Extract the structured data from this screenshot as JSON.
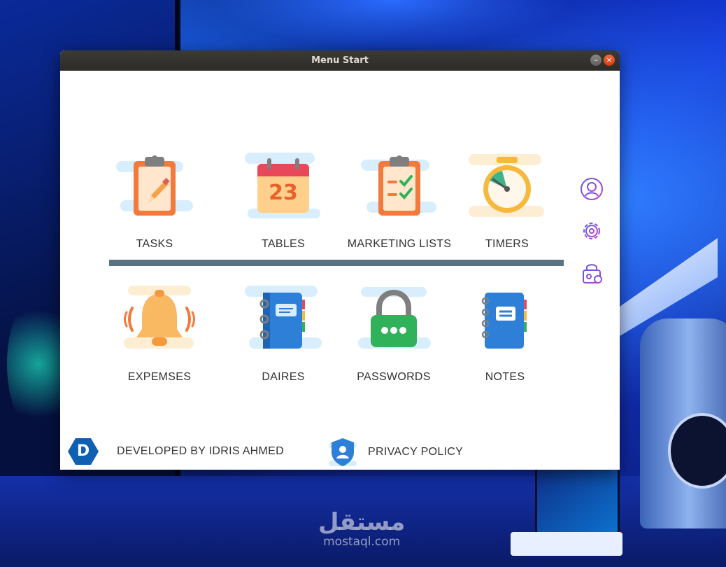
{
  "window": {
    "title": "Menu Start",
    "minimize_icon": "minimize-icon",
    "close_icon": "close-icon"
  },
  "menu_top": [
    {
      "label": "TASKS",
      "icon": "clipboard-pencil-icon"
    },
    {
      "label": "TABLES",
      "icon": "calendar-icon",
      "calendar_day": "23"
    },
    {
      "label": "MARKETING LISTS",
      "icon": "checklist-icon"
    },
    {
      "label": "TIMERS",
      "icon": "stopwatch-icon"
    }
  ],
  "menu_bottom": [
    {
      "label": "EXPEMSES",
      "icon": "bell-icon"
    },
    {
      "label": "DAIRES",
      "icon": "diary-icon"
    },
    {
      "label": "PASSWORDS",
      "icon": "padlock-icon"
    },
    {
      "label": "NOTES",
      "icon": "notebook-icon"
    }
  ],
  "side_icons": [
    "user-profile-icon",
    "settings-gear-icon",
    "lock-settings-icon"
  ],
  "footer": {
    "developer_text": "DEVELOPED BY IDRIS AHMED",
    "developer_logo_letter": "D",
    "privacy_text": "PRIVACY POLICY"
  },
  "background": {
    "watermark_arabic": "مستقل",
    "watermark_latin": "mostaql.com"
  },
  "colors": {
    "divider": "#5b7380",
    "accent_purple": "#8a3fd6",
    "logo_blue": "#0f5fb3"
  }
}
